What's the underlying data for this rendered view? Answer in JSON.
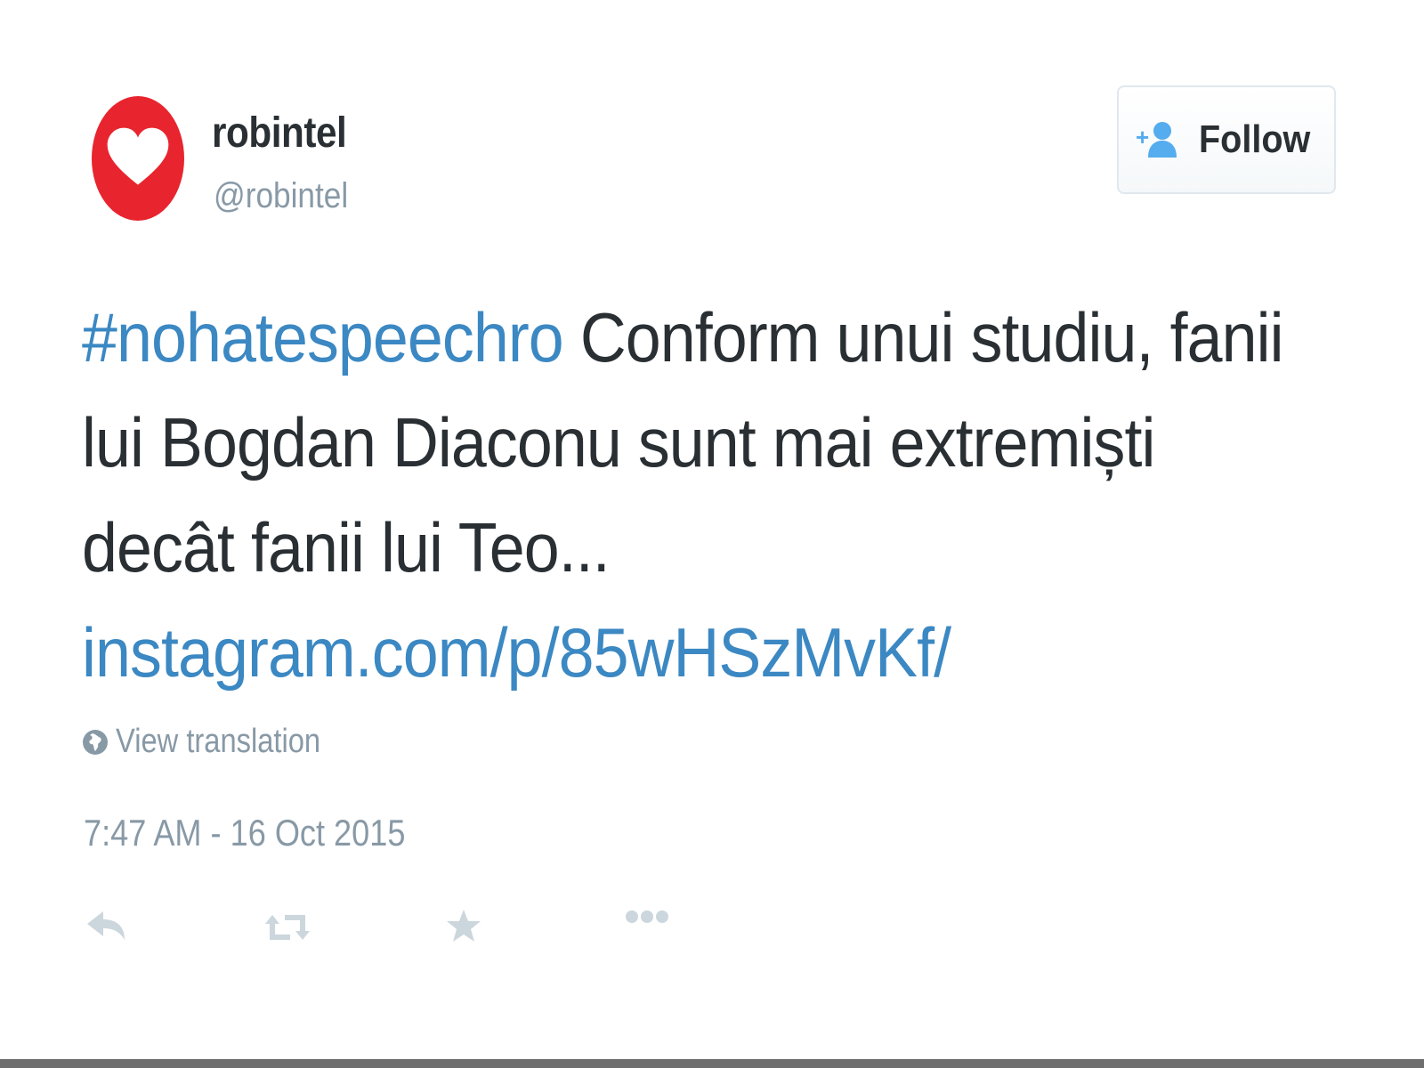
{
  "user": {
    "display_name": "robintel",
    "handle": "@robintel"
  },
  "follow_button": {
    "label": "Follow"
  },
  "tweet": {
    "hashtag": "#nohatespeechro",
    "text_line1": " Conform unui studiu, fanii",
    "text_line2": "lui Bogdan Diaconu sunt mai extremiști",
    "text_line3": "decât fanii lui Teo...",
    "link": "instagram.com/p/85wHSzMvKf/"
  },
  "translation": {
    "label": "View translation"
  },
  "timestamp": "7:47 AM - 16 Oct 2015",
  "actions": [
    "reply-icon",
    "retweet-icon",
    "favorite-icon",
    "more-icon"
  ],
  "colors": {
    "link": "#3b88c3",
    "text": "#292f33",
    "muted": "#8899a6",
    "avatar": "#e8242e",
    "follow_icon": "#55acee"
  }
}
